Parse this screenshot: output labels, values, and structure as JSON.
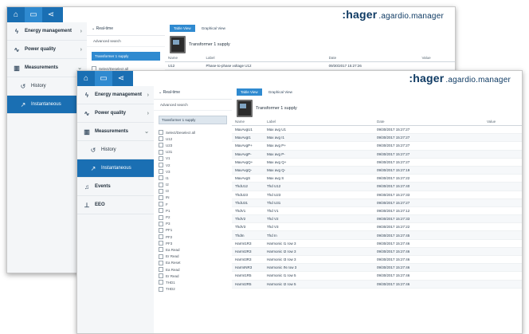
{
  "brand": {
    "name": ":hager",
    "product": ".agardio.manager"
  },
  "topbar_icons": [
    "home-icon",
    "monitor-icon",
    "share-icon"
  ],
  "nav": [
    {
      "label": "Energy management",
      "icon": "lightning-icon",
      "chevron": "›"
    },
    {
      "label": "Power quality",
      "icon": "wave-icon",
      "chevron": "›"
    },
    {
      "label": "Measurements",
      "icon": "chart-icon",
      "chevron": "⌄"
    },
    {
      "label": "History",
      "icon": "history-icon"
    },
    {
      "label": "Instantaneous",
      "icon": "trend-icon"
    },
    {
      "label": "Events",
      "icon": "bell-icon"
    },
    {
      "label": "EEO",
      "icon": "network-icon"
    }
  ],
  "tree": {
    "realtime_label": "Real-time",
    "advanced_search": "Advanced search",
    "selected_device": "Transformer 1 supply",
    "select_all": "Select/Deselect all",
    "channels": [
      "U12",
      "U23",
      "U31",
      "V1",
      "V2",
      "V3",
      "I1",
      "I2",
      "I3",
      "IN",
      "F",
      "P1",
      "P2",
      "P3",
      "PF1",
      "PF2",
      "PF3",
      "Ea Read",
      "Er Read",
      "Ea Reset",
      "Ea Read",
      "Er Read",
      "THD1",
      "THD2"
    ]
  },
  "content": {
    "tab_table": "Table View",
    "tab_graph": "Graphical View",
    "device_title": "Transformer 1 supply",
    "columns": [
      "Name",
      "Label",
      "Date",
      "Value"
    ],
    "rows": [
      [
        "MaxAvgU1",
        "Max avg U1",
        "09/30/2017 15:27:27",
        ""
      ],
      [
        "MaxAvgI1",
        "Max avg I1",
        "09/30/2017 15:27:27",
        ""
      ],
      [
        "MaxAvgP+",
        "Max avg P+",
        "09/30/2017 15:27:27",
        ""
      ],
      [
        "MaxAvgP-",
        "Max avg P-",
        "09/30/2017 15:27:27",
        ""
      ],
      [
        "MaxAvgQ+",
        "Max avg Q+",
        "09/30/2017 15:27:27",
        ""
      ],
      [
        "MaxAvgQ-",
        "Max avg Q-",
        "09/30/2017 15:27:19",
        ""
      ],
      [
        "MaxAvgS",
        "Max avg S",
        "09/30/2017 15:27:22",
        ""
      ],
      [
        "ThdU12",
        "Thd U12",
        "09/30/2017 15:27:40",
        ""
      ],
      [
        "ThdU23",
        "Thd U23",
        "09/30/2017 15:27:33",
        ""
      ],
      [
        "ThdU31",
        "Thd U31",
        "09/30/2017 15:27:27",
        ""
      ],
      [
        "ThdV1",
        "Thd V1",
        "09/30/2017 15:27:12",
        ""
      ],
      [
        "ThdV2",
        "Thd V2",
        "09/30/2017 15:27:33",
        ""
      ],
      [
        "ThdV3",
        "Thd V3",
        "09/30/2017 15:27:22",
        ""
      ],
      [
        "ThdIn",
        "Thd In",
        "09/30/2017 15:27:45",
        ""
      ],
      [
        "HarmI1R3",
        "Harmonic I1 row 3",
        "09/30/2017 15:27:46",
        ""
      ],
      [
        "HarmI2R3",
        "Harmonic I2 row 3",
        "09/30/2017 15:27:46",
        ""
      ],
      [
        "HarmI3R3",
        "Harmonic I3 row 3",
        "09/30/2017 15:27:46",
        ""
      ],
      [
        "HarmINR3",
        "Harmonic IN row 3",
        "09/30/2017 15:27:46",
        ""
      ],
      [
        "HarmI1R5",
        "Harmonic I1 row 5",
        "09/30/2017 15:27:46",
        ""
      ],
      [
        "HarmI2R5",
        "Harmonic I2 row 5",
        "09/30/2017 15:27:46",
        ""
      ]
    ],
    "back_row": [
      "U12",
      "Phase-to-phase voltage U12",
      "09/30/2017 15:27:26",
      ""
    ]
  }
}
